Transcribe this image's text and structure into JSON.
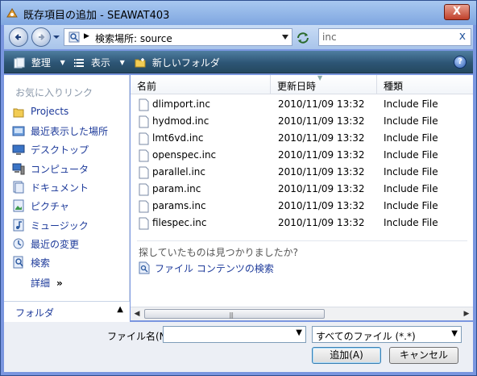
{
  "window": {
    "title": "既存項目の追加 - SEAWAT403",
    "close_label": "X"
  },
  "nav": {
    "address_text": "検索場所: source",
    "search_value": "inc",
    "clear_label": "x"
  },
  "toolbar": {
    "organize_label": "整理",
    "views_label": "表示",
    "new_folder_label": "新しいフォルダ",
    "help_label": "?"
  },
  "sidebar": {
    "heading": "お気に入りリンク",
    "items": [
      {
        "label": "Projects",
        "icon": "folder-icon"
      },
      {
        "label": "最近表示した場所",
        "icon": "recent-places-icon"
      },
      {
        "label": "デスクトップ",
        "icon": "desktop-icon"
      },
      {
        "label": "コンピュータ",
        "icon": "computer-icon"
      },
      {
        "label": "ドキュメント",
        "icon": "documents-icon"
      },
      {
        "label": "ピクチャ",
        "icon": "pictures-icon"
      },
      {
        "label": "ミュージック",
        "icon": "music-icon"
      },
      {
        "label": "最近の変更",
        "icon": "recently-changed-icon"
      },
      {
        "label": "検索",
        "icon": "searches-icon"
      }
    ],
    "more_label": "詳細",
    "more_chevron": "»",
    "folders_label": "フォルダ"
  },
  "list": {
    "columns": [
      "名前",
      "更新日時",
      "種類"
    ],
    "rows": [
      {
        "name": "dlimport.inc",
        "date": "2010/11/09 13:32",
        "type": "Include File"
      },
      {
        "name": "hydmod.inc",
        "date": "2010/11/09 13:32",
        "type": "Include File"
      },
      {
        "name": "lmt6vd.inc",
        "date": "2010/11/09 13:32",
        "type": "Include File"
      },
      {
        "name": "openspec.inc",
        "date": "2010/11/09 13:32",
        "type": "Include File"
      },
      {
        "name": "parallel.inc",
        "date": "2010/11/09 13:32",
        "type": "Include File"
      },
      {
        "name": "param.inc",
        "date": "2010/11/09 13:32",
        "type": "Include File"
      },
      {
        "name": "params.inc",
        "date": "2010/11/09 13:32",
        "type": "Include File"
      },
      {
        "name": "filespec.inc",
        "date": "2010/11/09 13:32",
        "type": "Include File"
      }
    ],
    "not_found_hint": "探していたものは見つかりましたか?",
    "search_contents_label": "ファイル コンテンツの検索"
  },
  "footer": {
    "filename_label": "ファイル名(N):",
    "filename_value": "",
    "filter_value": "すべてのファイル (*.*)",
    "add_button": "追加(A)",
    "cancel_button": "キャンセル"
  },
  "colors": {
    "toolbar_bg": "#2d5575",
    "link_blue": "#1d3a9a",
    "title_bar": "#7fa6e0",
    "close_red": "#c0402a"
  }
}
